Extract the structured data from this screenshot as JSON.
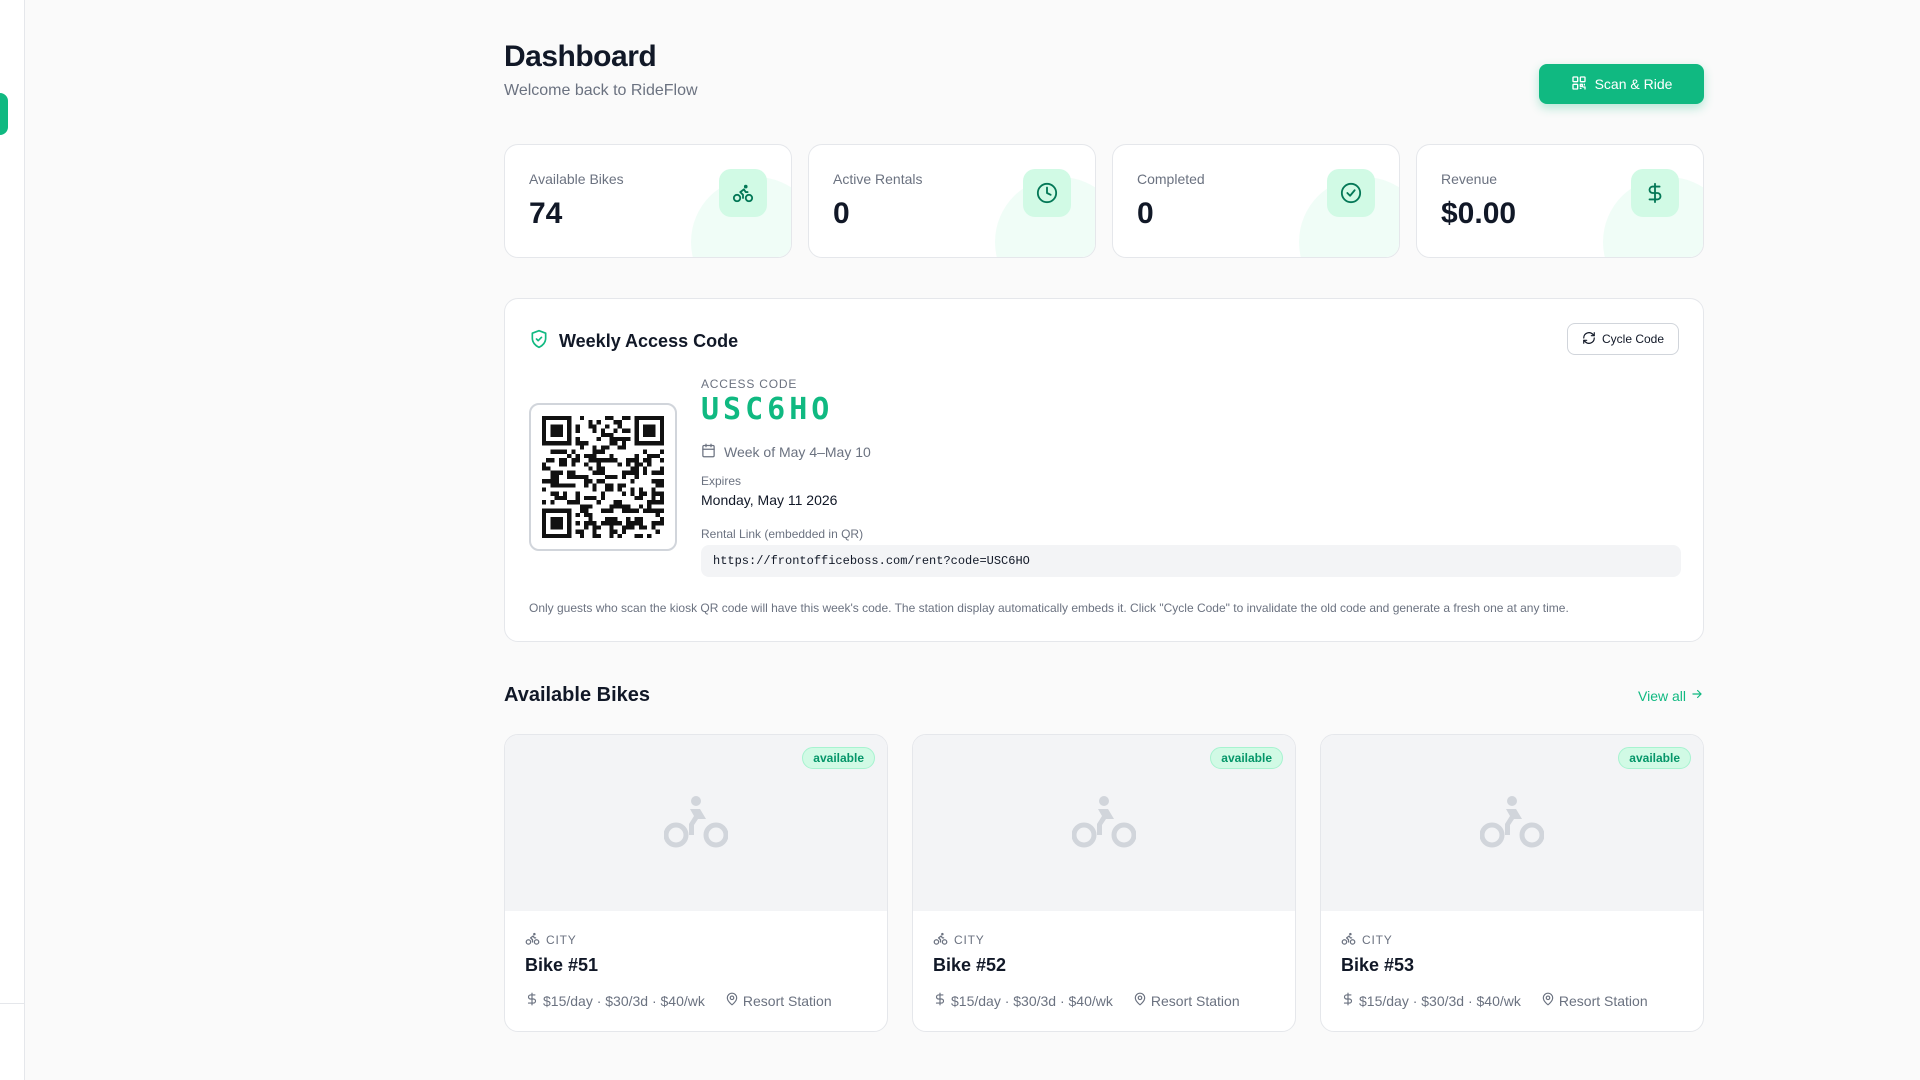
{
  "header": {
    "title": "Dashboard",
    "subtitle": "Welcome back to RideFlow",
    "scan_button_label": "Scan & Ride"
  },
  "stats": [
    {
      "label": "Available Bikes",
      "value": "74",
      "icon": "bicycle-icon"
    },
    {
      "label": "Active Rentals",
      "value": "0",
      "icon": "clock-icon"
    },
    {
      "label": "Completed",
      "value": "0",
      "icon": "check-circle-icon"
    },
    {
      "label": "Revenue",
      "value": "$0.00",
      "icon": "dollar-icon"
    }
  ],
  "access_code": {
    "title": "Weekly Access Code",
    "cycle_button_label": "Cycle Code",
    "code_label": "ACCESS CODE",
    "code": "USC6HO",
    "week": "Week of May 4–May 10",
    "expires_label": "Expires",
    "expires_value": "Monday, May 11 2026",
    "link_label": "Rental Link (embedded in QR)",
    "link": "https://frontofficeboss.com/rent?code=USC6HO",
    "note": "Only guests who scan the kiosk QR code will have this week's code. The station display automatically embeds it. Click \"Cycle Code\" to invalidate the old code and generate a fresh one at any time."
  },
  "bikes": {
    "title": "Available Bikes",
    "view_all_label": "View all",
    "items": [
      {
        "badge": "available",
        "type": "CITY",
        "name": "Bike #51",
        "pricing": "$15/day · $30/3d · $40/wk",
        "location": "Resort Station"
      },
      {
        "badge": "available",
        "type": "CITY",
        "name": "Bike #52",
        "pricing": "$15/day · $30/3d · $40/wk",
        "location": "Resort Station"
      },
      {
        "badge": "available",
        "type": "CITY",
        "name": "Bike #53",
        "pricing": "$15/day · $30/3d · $40/wk",
        "location": "Resort Station"
      }
    ]
  },
  "colors": {
    "accent": "#10b981",
    "accent_light": "#d1fae5",
    "background": "#fafafa"
  }
}
